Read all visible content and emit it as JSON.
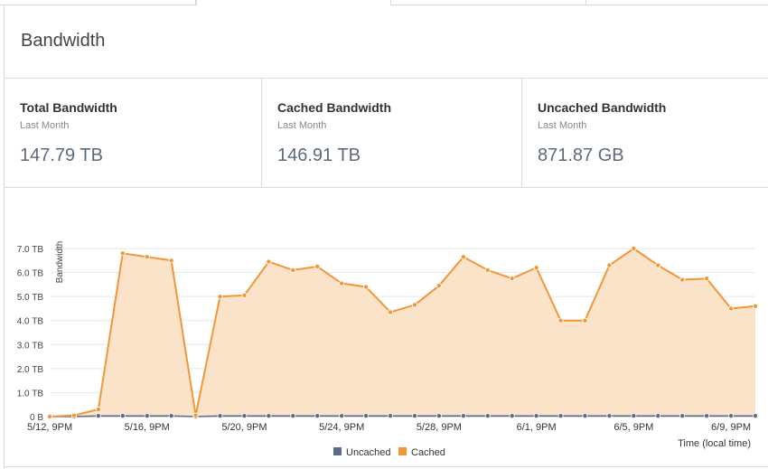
{
  "panel": {
    "title": "Bandwidth"
  },
  "stats": [
    {
      "title": "Total Bandwidth",
      "period": "Last Month",
      "value": "147.79 TB"
    },
    {
      "title": "Cached Bandwidth",
      "period": "Last Month",
      "value": "146.91 TB"
    },
    {
      "title": "Uncached Bandwidth",
      "period": "Last Month",
      "value": "871.87 GB"
    }
  ],
  "colors": {
    "cached": "#f0973a",
    "cached_fill": "#fbe3c9",
    "uncached": "#5b6b8c"
  },
  "chart_data": {
    "type": "area",
    "ylabel": "Bandwidth",
    "xlabel": "Time (local time)",
    "y_unit": "TB",
    "ylim": [
      0,
      7
    ],
    "yticks": [
      "0 B",
      "1.0 TB",
      "2.0 TB",
      "3.0 TB",
      "4.0 TB",
      "5.0 TB",
      "6.0 TB",
      "7.0 TB"
    ],
    "xticks": [
      {
        "index": 0,
        "label": "5/12, 9PM"
      },
      {
        "index": 4,
        "label": "5/16, 9PM"
      },
      {
        "index": 8,
        "label": "5/20, 9PM"
      },
      {
        "index": 12,
        "label": "5/24, 9PM"
      },
      {
        "index": 16,
        "label": "5/28, 9PM"
      },
      {
        "index": 20,
        "label": "6/1, 9PM"
      },
      {
        "index": 24,
        "label": "6/5, 9PM"
      },
      {
        "index": 28,
        "label": "6/9, 9PM"
      }
    ],
    "grid": true,
    "legend": "bottom-center",
    "series": [
      {
        "name": "Uncached",
        "values": [
          0.0,
          0.0,
          0.03,
          0.03,
          0.03,
          0.03,
          0.0,
          0.03,
          0.03,
          0.03,
          0.03,
          0.03,
          0.03,
          0.03,
          0.03,
          0.03,
          0.03,
          0.03,
          0.03,
          0.03,
          0.03,
          0.03,
          0.03,
          0.03,
          0.03,
          0.03,
          0.03,
          0.03,
          0.03,
          0.03,
          0.03
        ]
      },
      {
        "name": "Cached",
        "values": [
          0.0,
          0.05,
          0.3,
          6.8,
          6.65,
          6.5,
          0.05,
          5.0,
          5.05,
          6.45,
          6.1,
          6.25,
          5.55,
          5.4,
          4.35,
          4.65,
          5.45,
          6.65,
          6.1,
          5.75,
          6.2,
          4.0,
          4.0,
          6.3,
          7.0,
          6.3,
          5.7,
          5.75,
          4.5,
          4.6
        ]
      }
    ]
  }
}
